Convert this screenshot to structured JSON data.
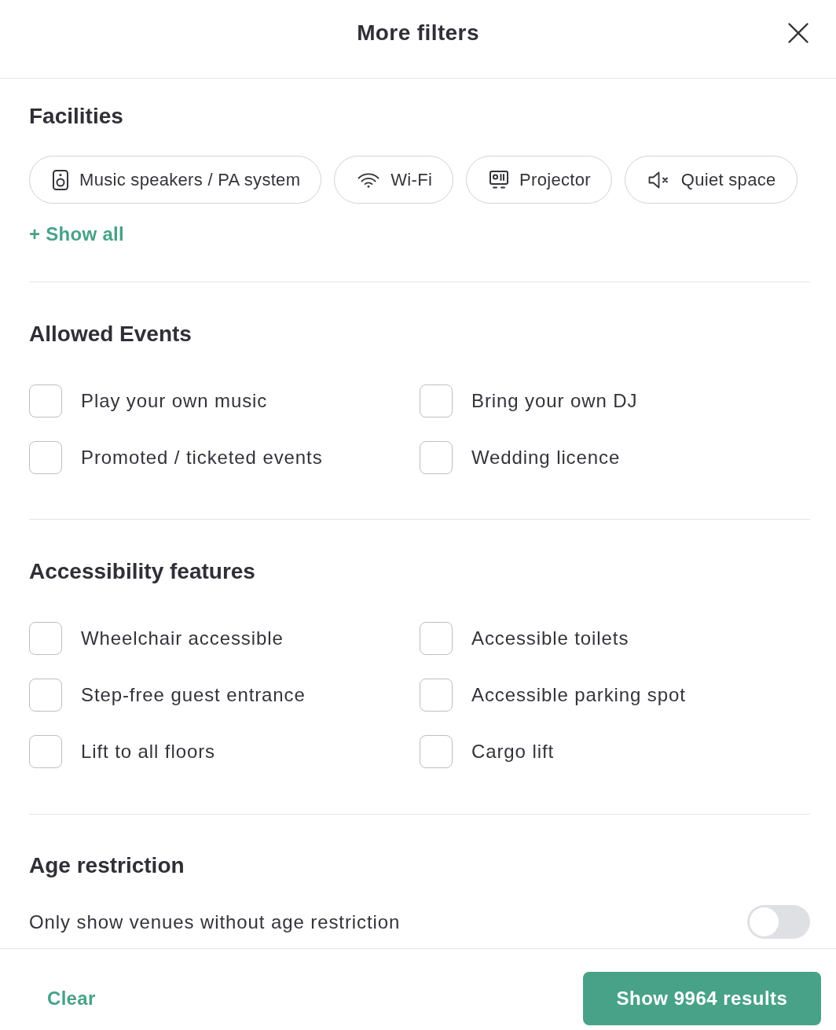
{
  "header": {
    "title": "More filters"
  },
  "facilities": {
    "heading": "Facilities",
    "chips": [
      {
        "label": "Music speakers / PA system",
        "selected": false
      },
      {
        "label": "Wi-Fi",
        "selected": false
      },
      {
        "label": "Projector",
        "selected": false
      },
      {
        "label": "Quiet space",
        "selected": false
      }
    ],
    "show_all": "+ Show all"
  },
  "allowed_events": {
    "heading": "Allowed Events",
    "options": [
      {
        "label": "Play your own music",
        "checked": false
      },
      {
        "label": "Bring your own DJ",
        "checked": false
      },
      {
        "label": "Promoted / ticketed events",
        "checked": false
      },
      {
        "label": "Wedding licence",
        "checked": false
      }
    ]
  },
  "accessibility": {
    "heading": "Accessibility features",
    "options": [
      {
        "label": "Wheelchair accessible",
        "checked": false
      },
      {
        "label": "Accessible toilets",
        "checked": false
      },
      {
        "label": "Step-free guest entrance",
        "checked": false
      },
      {
        "label": "Accessible parking spot",
        "checked": false
      },
      {
        "label": "Lift to all floors",
        "checked": false
      },
      {
        "label": "Cargo lift",
        "checked": false
      }
    ]
  },
  "age_restriction": {
    "heading": "Age restriction",
    "label": "Only show venues without age restriction",
    "on": false
  },
  "footer": {
    "clear": "Clear",
    "submit": "Show 9964 results"
  }
}
